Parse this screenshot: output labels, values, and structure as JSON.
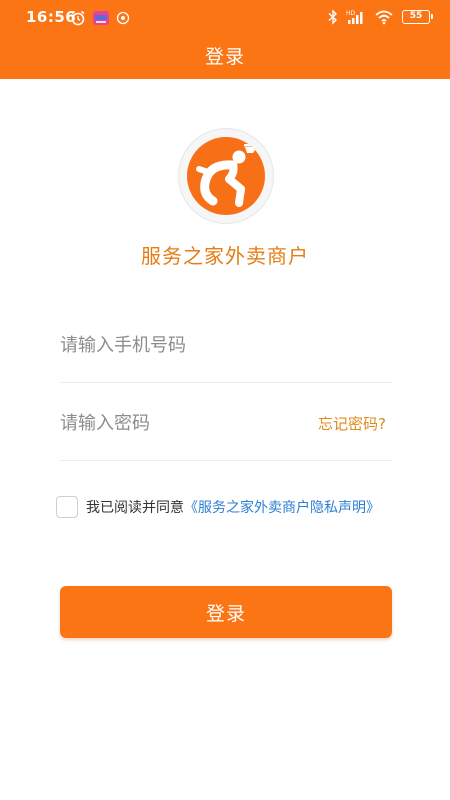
{
  "status_bar": {
    "time": "16:56",
    "battery": "55",
    "signal_label": "HD"
  },
  "header": {
    "title": "登录"
  },
  "brand": {
    "name": "服务之家外卖商户",
    "logo_color": "#f76f16"
  },
  "form": {
    "phone_placeholder": "请输入手机号码",
    "phone_value": "",
    "password_placeholder": "请输入密码",
    "password_value": "",
    "forgot_label": "忘记密码?",
    "agree_prefix": "我已阅读并同意",
    "privacy_link": "《服务之家外卖商户隐私声明》",
    "agree_checked": false
  },
  "actions": {
    "login_label": "登录"
  },
  "colors": {
    "primary": "#fb7515",
    "brand_text": "#e47d16",
    "link": "#2c7fd4"
  }
}
